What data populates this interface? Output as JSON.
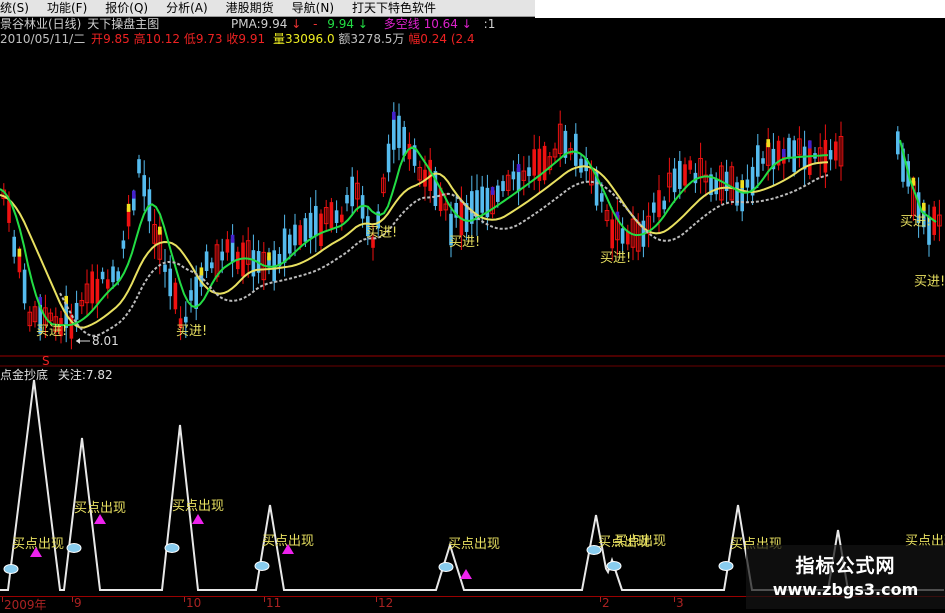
{
  "menu": [
    {
      "label": "统(S)",
      "name": "menu-system"
    },
    {
      "label": "功能(F)",
      "name": "menu-function"
    },
    {
      "label": "报价(Q)",
      "name": "menu-quote"
    },
    {
      "label": "分析(A)",
      "name": "menu-analysis"
    },
    {
      "label": "港股期货",
      "name": "menu-hk-futures"
    },
    {
      "label": "导航(N)",
      "name": "menu-navigation"
    },
    {
      "label": "打天下特色软件",
      "name": "menu-special-software"
    }
  ],
  "info1": {
    "stock": "景谷林业(日线)",
    "chart_title": "天下操盘主图",
    "pma": "PMA:9.94",
    "pma_arrow": "↓",
    "dash": "-",
    "v2": "9.94",
    "v2_arrow": "↓",
    "lbl3": "多空线",
    "v3": "10.64",
    "v3_arrow": "↓",
    "tail": ":1"
  },
  "info2": {
    "date": "2010/05/11/二",
    "open_label": "开",
    "open": "9.85",
    "high_label": "高",
    "high": "10.12",
    "low_label": "低",
    "low": "9.73",
    "close_label": "收",
    "close": "9.91",
    "vol_label": "量",
    "vol": "33096.0",
    "amt_label": "额",
    "amt": "3278.5万",
    "chg_label": "幅",
    "chg": "0.24",
    "chg_tail": "(2.4"
  },
  "main_chart": {
    "low_marker": "8.01",
    "buy_label": "买进!",
    "buy_signals": [
      48,
      188,
      378,
      461,
      612,
      912,
      926
    ]
  },
  "indicator": {
    "name": "点金抄底",
    "focus_label": "关注:7.82",
    "signal_label": "买点出现",
    "s_mark": "S"
  },
  "x_axis": [
    "2009年",
    "9",
    "10",
    "11",
    "12",
    "2",
    "3"
  ],
  "watermark": {
    "title": "指标公式网",
    "url": "www.zbgs3.com"
  },
  "colors": {
    "up": "#ee1111",
    "down": "#55bbee",
    "ma1": "#e8e060",
    "ma2": "#22dd44",
    "ma3": "#bbbbbb"
  }
}
